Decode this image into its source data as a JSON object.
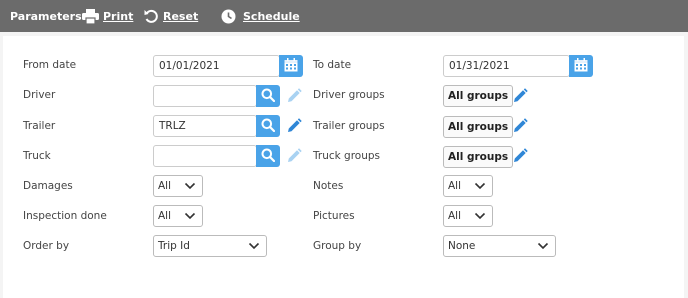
{
  "toolbar": {
    "title": "Parameters",
    "print_label": "Print",
    "reset_label": "Reset",
    "schedule_label": "Schedule",
    "background": "#6b6b6b"
  },
  "form": {
    "from_date": {
      "label": "From date",
      "value": "01/01/2021"
    },
    "to_date": {
      "label": "To date",
      "value": "01/31/2021"
    },
    "driver": {
      "label": "Driver",
      "value": ""
    },
    "driver_groups": {
      "label": "Driver groups",
      "value": "All groups"
    },
    "trailer": {
      "label": "Trailer",
      "value": "TRLZ"
    },
    "trailer_groups": {
      "label": "Trailer groups",
      "value": "All groups"
    },
    "truck": {
      "label": "Truck",
      "value": ""
    },
    "truck_groups": {
      "label": "Truck groups",
      "value": "All groups"
    },
    "damages": {
      "label": "Damages",
      "value": "All"
    },
    "notes": {
      "label": "Notes",
      "value": "All"
    },
    "inspection_done": {
      "label": "Inspection done",
      "value": "All"
    },
    "pictures": {
      "label": "Pictures",
      "value": "All"
    },
    "order_by": {
      "label": "Order by",
      "value": "Trip Id"
    },
    "group_by": {
      "label": "Group by",
      "value": "None"
    }
  },
  "colors": {
    "accent": "#4aa3e8",
    "pencil_active": "#2f86d6",
    "pencil_disabled": "#a9d2f2"
  },
  "icons": {
    "print": "printer-icon",
    "reset": "undo-icon",
    "schedule": "clock-icon",
    "calendar": "calendar-icon",
    "search": "search-icon",
    "edit": "pencil-icon",
    "dropdown": "chevron-down-icon"
  }
}
